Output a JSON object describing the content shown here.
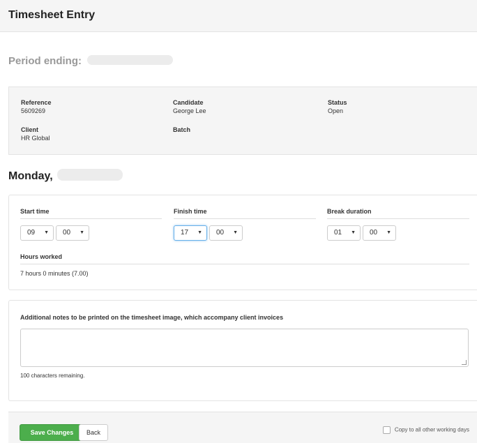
{
  "header": {
    "title": "Timesheet Entry"
  },
  "period": {
    "label": "Period ending:"
  },
  "info": {
    "reference": {
      "label": "Reference",
      "value": "5609269"
    },
    "candidate": {
      "label": "Candidate",
      "value": "George Lee"
    },
    "status": {
      "label": "Status",
      "value": "Open"
    },
    "client": {
      "label": "Client",
      "value": "HR Global"
    },
    "batch": {
      "label": "Batch",
      "value": ""
    }
  },
  "day": {
    "label": "Monday,"
  },
  "times": {
    "start": {
      "label": "Start time",
      "hour": "09",
      "minute": "00"
    },
    "finish": {
      "label": "Finish time",
      "hour": "17",
      "minute": "00"
    },
    "break": {
      "label": "Break duration",
      "hour": "01",
      "minute": "00"
    },
    "dropdown_arrow": "▼",
    "hours_worked_label": "Hours worked",
    "hours_worked_value": "7 hours 0 minutes (7.00)"
  },
  "notes": {
    "label": "Additional notes to be printed on the timesheet image, which accompany client invoices",
    "value": "",
    "remaining": "100 characters remaining."
  },
  "footer": {
    "save_label": "Save Changes",
    "back_label": "Back",
    "copy_label": "Copy to all other working days",
    "copy_checked": false
  },
  "colors": {
    "save_button": "#4cae4c",
    "focus_ring": "#66afe9",
    "panel_bg": "#f5f5f5"
  }
}
